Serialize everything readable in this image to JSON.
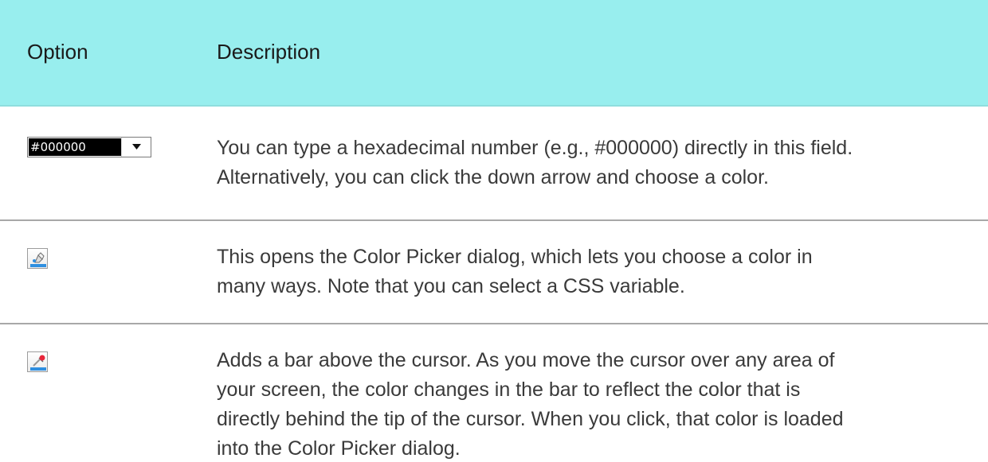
{
  "header": {
    "option_label": "Option",
    "description_label": "Description"
  },
  "rows": [
    {
      "option": {
        "type": "hex-dropdown",
        "value": "#000000",
        "icon": "chevron-down-icon"
      },
      "description_lines": [
        "You can type a hexadecimal number (e.g., #000000) directly in this field.",
        "Alternatively, you can click the down arrow and choose a color."
      ]
    },
    {
      "option": {
        "type": "icon",
        "icon": "color-picker-icon"
      },
      "description_lines": [
        "This opens the Color Picker dialog, which lets you choose a color in",
        "many ways. Note that you can select a CSS variable."
      ]
    },
    {
      "option": {
        "type": "icon",
        "icon": "eyedropper-icon"
      },
      "description_lines": [
        "Adds a bar above the cursor. As you move the cursor over any area of",
        "your screen, the color changes in the bar to reflect the color that is",
        "directly behind the tip of the cursor. When you click, that color is loaded",
        "into the Color Picker dialog."
      ]
    }
  ],
  "colors": {
    "header_bg": "#98eeee",
    "text": "#3a3a3a",
    "divider": "#a8a8a8"
  }
}
